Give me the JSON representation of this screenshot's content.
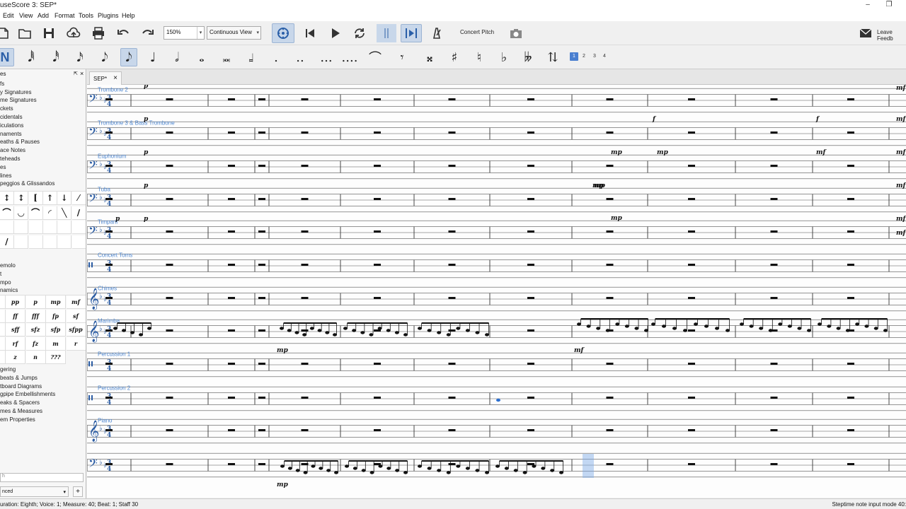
{
  "window": {
    "title": "useScore 3: SEP*",
    "minimize": "–",
    "restore": "❐"
  },
  "menu": [
    "Edit",
    "View",
    "Add",
    "Format",
    "Tools",
    "Plugins",
    "Help"
  ],
  "toolbar": {
    "zoom": "150%",
    "view_mode": "Continuous View",
    "concert_pitch": "Concert Pitch",
    "feedback": "Leave Feedb"
  },
  "note_input": {
    "voices": [
      "1",
      "2",
      "3",
      "4"
    ],
    "selected_voice": "1"
  },
  "palette": {
    "items_top": [
      "es",
      "fs",
      "y Signatures",
      "me Signatures",
      "ckets",
      "cidentals",
      "iculations",
      "naments",
      "eaths & Pauses",
      "ace Notes",
      "teheads",
      "es",
      "lines",
      "peggios & Glissandos"
    ],
    "items_mid": [
      "emolo",
      "t",
      "mpo",
      "namics"
    ],
    "dynamics": [
      "pp",
      "p",
      "mp",
      "mf",
      "ff",
      "fff",
      "fp",
      "sf",
      "sff",
      "sfz",
      "sfp",
      "sfpp",
      "rf",
      "fz",
      "m",
      "r",
      "z",
      "n",
      "???"
    ],
    "items_bottom": [
      "gering",
      "beats & Jumps",
      "tboard Diagrams",
      "gpipe Embellishments",
      "eaks & Spacers",
      "mes & Measures",
      "em Properties"
    ],
    "search_placeholder": "h",
    "mode": "nced",
    "add": "+"
  },
  "tab": {
    "label": "SEP*",
    "close": "×"
  },
  "score": {
    "instruments": [
      "Trombone 2",
      "Trombone 3 & Bass Trombone",
      "Euphonium",
      "Tuba",
      "Timpani",
      "Concert Toms",
      "Chimes",
      "Marimba",
      "Percussion 1",
      "Percussion 2",
      "Piano"
    ],
    "dynamics_marks": [
      "p",
      "p",
      "p",
      "p",
      "p",
      "mp",
      "mp",
      "mp",
      "mp",
      "mp",
      "mf",
      "f",
      "f",
      "mf",
      "mf",
      "mf",
      "mf",
      "mf",
      "mf",
      "mp",
      "mf",
      "mp",
      "p"
    ]
  },
  "status": {
    "left": "uration: Eighth; Voice: 1;  Measure: 40; Beat: 1; Staff 30",
    "right": "Steptime note input mode   40:"
  }
}
